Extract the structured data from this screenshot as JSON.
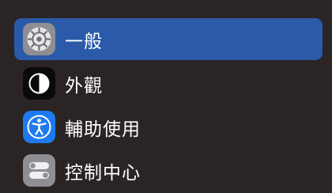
{
  "sidebar": {
    "items": [
      {
        "label": "一般",
        "icon": "gear-icon",
        "selected": true
      },
      {
        "label": "外觀",
        "icon": "appearance-icon",
        "selected": false
      },
      {
        "label": "輔助使用",
        "icon": "accessibility-icon",
        "selected": false
      },
      {
        "label": "控制中心",
        "icon": "control-center-icon",
        "selected": false
      }
    ]
  },
  "colors": {
    "background": "#2a2524",
    "selected": "#2a5aa8",
    "accessibility_icon_bg": "#1e7af0"
  }
}
